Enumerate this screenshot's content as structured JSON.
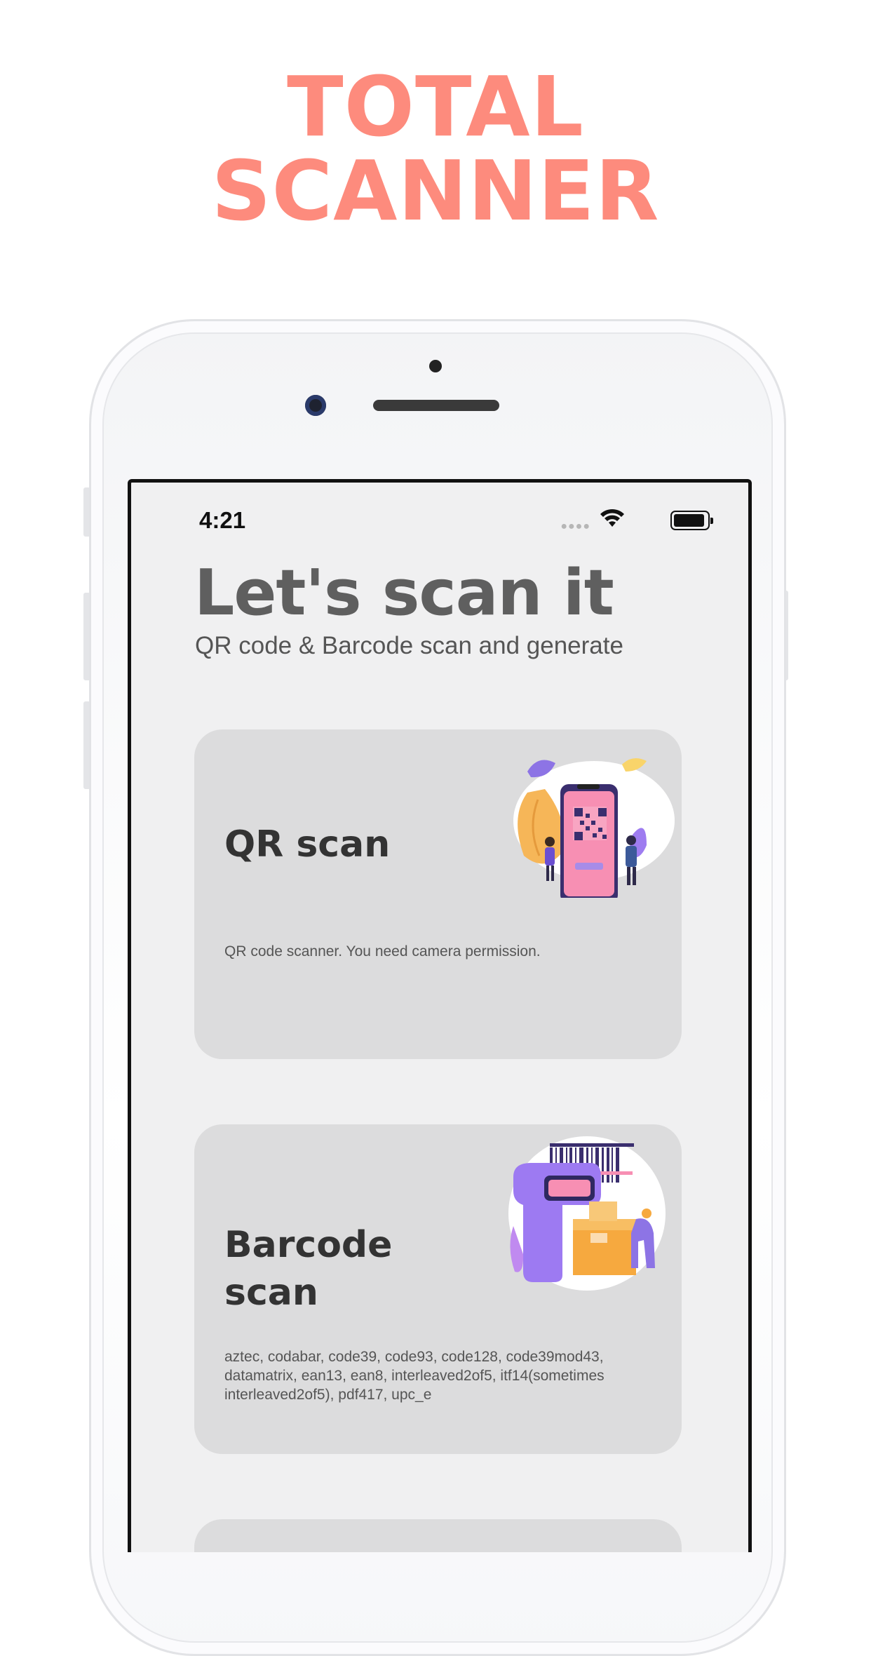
{
  "promo": {
    "line1": "TOTAL",
    "line2": "SCANNER",
    "color": "#FD8B7D"
  },
  "status_bar": {
    "time": "4:21",
    "signal_icon": "signal-dots-icon",
    "wifi_icon": "wifi-icon",
    "battery_icon": "battery-icon"
  },
  "header": {
    "title": "Let's scan it",
    "subtitle": "QR code & Barcode scan and generate"
  },
  "cards": [
    {
      "title": "QR scan",
      "description": "QR code scanner. You need camera permission.",
      "illustration": "qr-scan-illustration"
    },
    {
      "title_line1": "Barcode",
      "title_line2": "scan",
      "description": "aztec, codabar, code39, code93, code128, code39mod43, datamatrix, ean13, ean8, interleaved2of5, itf14(sometimes interleaved2of5), pdf417, upc_e",
      "illustration": "barcode-scan-illustration"
    }
  ],
  "colors": {
    "screen_bg": "#f0f0f1",
    "card_bg": "#dcdcdd",
    "title_gray": "#5f5f5f"
  }
}
